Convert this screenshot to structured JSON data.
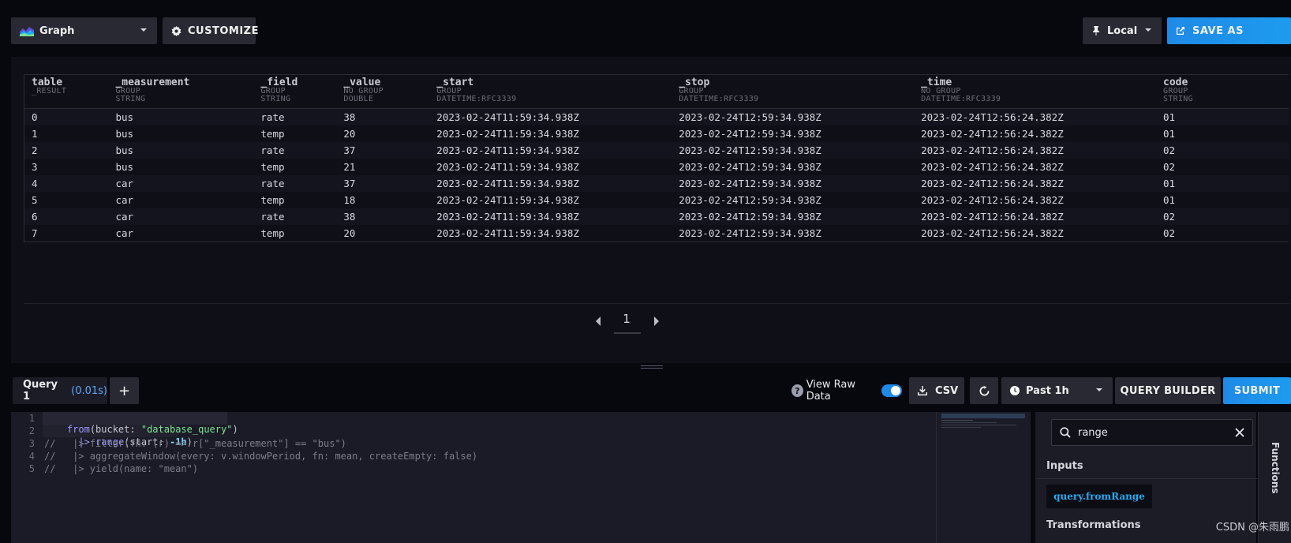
{
  "toolbar": {
    "view_type": "Graph",
    "customize_label": "CUSTOMIZE",
    "timezone": "Local",
    "save_as_label": "SAVE AS"
  },
  "results": {
    "columns": [
      {
        "name": "table",
        "meta1": "_RESULT",
        "meta2": "",
        "meta3": ""
      },
      {
        "name": "_measurement",
        "meta1": "GROUP",
        "meta2": "STRING",
        "meta3": ""
      },
      {
        "name": "_field",
        "meta1": "GROUP",
        "meta2": "STRING",
        "meta3": ""
      },
      {
        "name": "_value",
        "meta1": "NO GROUP",
        "meta2": "DOUBLE",
        "meta3": ""
      },
      {
        "name": "_start",
        "meta1": "GROUP",
        "meta2": "DATETIME:RFC3339",
        "meta3": ""
      },
      {
        "name": "_stop",
        "meta1": "GROUP",
        "meta2": "DATETIME:RFC3339",
        "meta3": ""
      },
      {
        "name": "_time",
        "meta1": "NO GROUP",
        "meta2": "DATETIME:RFC3339",
        "meta3": ""
      },
      {
        "name": "code",
        "meta1": "GROUP",
        "meta2": "STRING",
        "meta3": ""
      }
    ],
    "rows": [
      [
        "0",
        "bus",
        "rate",
        "38",
        "2023-02-24T11:59:34.938Z",
        "2023-02-24T12:59:34.938Z",
        "2023-02-24T12:56:24.382Z",
        "01"
      ],
      [
        "1",
        "bus",
        "temp",
        "20",
        "2023-02-24T11:59:34.938Z",
        "2023-02-24T12:59:34.938Z",
        "2023-02-24T12:56:24.382Z",
        "01"
      ],
      [
        "2",
        "bus",
        "rate",
        "37",
        "2023-02-24T11:59:34.938Z",
        "2023-02-24T12:59:34.938Z",
        "2023-02-24T12:56:24.382Z",
        "02"
      ],
      [
        "3",
        "bus",
        "temp",
        "21",
        "2023-02-24T11:59:34.938Z",
        "2023-02-24T12:59:34.938Z",
        "2023-02-24T12:56:24.382Z",
        "02"
      ],
      [
        "4",
        "car",
        "rate",
        "37",
        "2023-02-24T11:59:34.938Z",
        "2023-02-24T12:59:34.938Z",
        "2023-02-24T12:56:24.382Z",
        "01"
      ],
      [
        "5",
        "car",
        "temp",
        "18",
        "2023-02-24T11:59:34.938Z",
        "2023-02-24T12:59:34.938Z",
        "2023-02-24T12:56:24.382Z",
        "01"
      ],
      [
        "6",
        "car",
        "rate",
        "38",
        "2023-02-24T11:59:34.938Z",
        "2023-02-24T12:59:34.938Z",
        "2023-02-24T12:56:24.382Z",
        "02"
      ],
      [
        "7",
        "car",
        "temp",
        "20",
        "2023-02-24T11:59:34.938Z",
        "2023-02-24T12:59:34.938Z",
        "2023-02-24T12:56:24.382Z",
        "02"
      ]
    ],
    "page": "1"
  },
  "query_bar": {
    "tab_label": "Query 1",
    "tab_time": "(0.01s)",
    "add_label": "+",
    "raw_data_label": "View Raw Data",
    "raw_data_on": true,
    "csv_label": "CSV",
    "time_range": "Past 1h",
    "query_builder_label": "QUERY BUILDER",
    "submit_label": "SUBMIT"
  },
  "editor": {
    "line_numbers": [
      "1",
      "2",
      "3",
      "4",
      "5"
    ],
    "lines": {
      "l1_fn": "from",
      "l1_a": "(bucket: ",
      "l1_str": "\"database_query\"",
      "l1_b": ")",
      "l2_lead": "  ",
      "l2_pipe": "|>",
      "l2_fn": "range",
      "l2_a": "(start: ",
      "l2_num": "-1h",
      "l2_b": ")",
      "l3": "//   |> filter(fn: (r) => r[\"_measurement\"] == \"bus\")",
      "l4": "//   |> aggregateWindow(every: v.windowPeriod, fn: mean, createEmpty: false)",
      "l5": "//   |> yield(name: \"mean\")"
    }
  },
  "functions_panel": {
    "search_value": "range",
    "section_inputs": "Inputs",
    "fn_item": "query.fromRange",
    "section_transformations": "Transformations",
    "side_tab": "Functions"
  },
  "watermark": "CSDN @朱雨鹏",
  "colors": {
    "accent_blue": "#1f8ae6",
    "background": "#07070e",
    "panel": "#0f0f18",
    "button": "#292933"
  }
}
